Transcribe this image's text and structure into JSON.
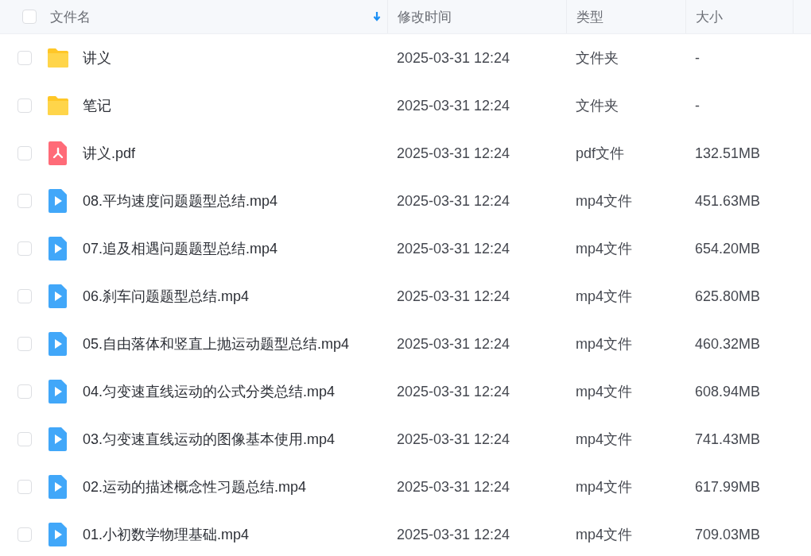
{
  "table": {
    "select_all": {
      "checked": false
    },
    "columns": [
      {
        "label": "文件名",
        "sorted_desc": true
      },
      {
        "label": "修改时间",
        "sorted_desc": false
      },
      {
        "label": "类型",
        "sorted_desc": false
      },
      {
        "label": "大小",
        "sorted_desc": false
      }
    ],
    "rows": [
      {
        "kind": "folder",
        "checked": false,
        "name": "讲义",
        "modified": "2025-03-31 12:24",
        "type": "文件夹",
        "size": "-"
      },
      {
        "kind": "folder",
        "checked": false,
        "name": "笔记",
        "modified": "2025-03-31 12:24",
        "type": "文件夹",
        "size": "-"
      },
      {
        "kind": "pdf",
        "checked": false,
        "name": "讲义.pdf",
        "modified": "2025-03-31 12:24",
        "type": "pdf文件",
        "size": "132.51MB"
      },
      {
        "kind": "video",
        "checked": false,
        "name": "08.平均速度问题题型总结.mp4",
        "modified": "2025-03-31 12:24",
        "type": "mp4文件",
        "size": "451.63MB"
      },
      {
        "kind": "video",
        "checked": false,
        "name": "07.追及相遇问题题型总结.mp4",
        "modified": "2025-03-31 12:24",
        "type": "mp4文件",
        "size": "654.20MB"
      },
      {
        "kind": "video",
        "checked": false,
        "name": "06.刹车问题题型总结.mp4",
        "modified": "2025-03-31 12:24",
        "type": "mp4文件",
        "size": "625.80MB"
      },
      {
        "kind": "video",
        "checked": false,
        "name": "05.自由落体和竖直上抛运动题型总结.mp4",
        "modified": "2025-03-31 12:24",
        "type": "mp4文件",
        "size": "460.32MB"
      },
      {
        "kind": "video",
        "checked": false,
        "name": "04.匀变速直线运动的公式分类总结.mp4",
        "modified": "2025-03-31 12:24",
        "type": "mp4文件",
        "size": "608.94MB"
      },
      {
        "kind": "video",
        "checked": false,
        "name": "03.匀变速直线运动的图像基本使用.mp4",
        "modified": "2025-03-31 12:24",
        "type": "mp4文件",
        "size": "741.43MB"
      },
      {
        "kind": "video",
        "checked": false,
        "name": "02.运动的描述概念性习题总结.mp4",
        "modified": "2025-03-31 12:24",
        "type": "mp4文件",
        "size": "617.99MB"
      },
      {
        "kind": "video",
        "checked": false,
        "name": "01.小初数学物理基础.mp4",
        "modified": "2025-03-31 12:24",
        "type": "mp4文件",
        "size": "709.03MB"
      }
    ]
  }
}
